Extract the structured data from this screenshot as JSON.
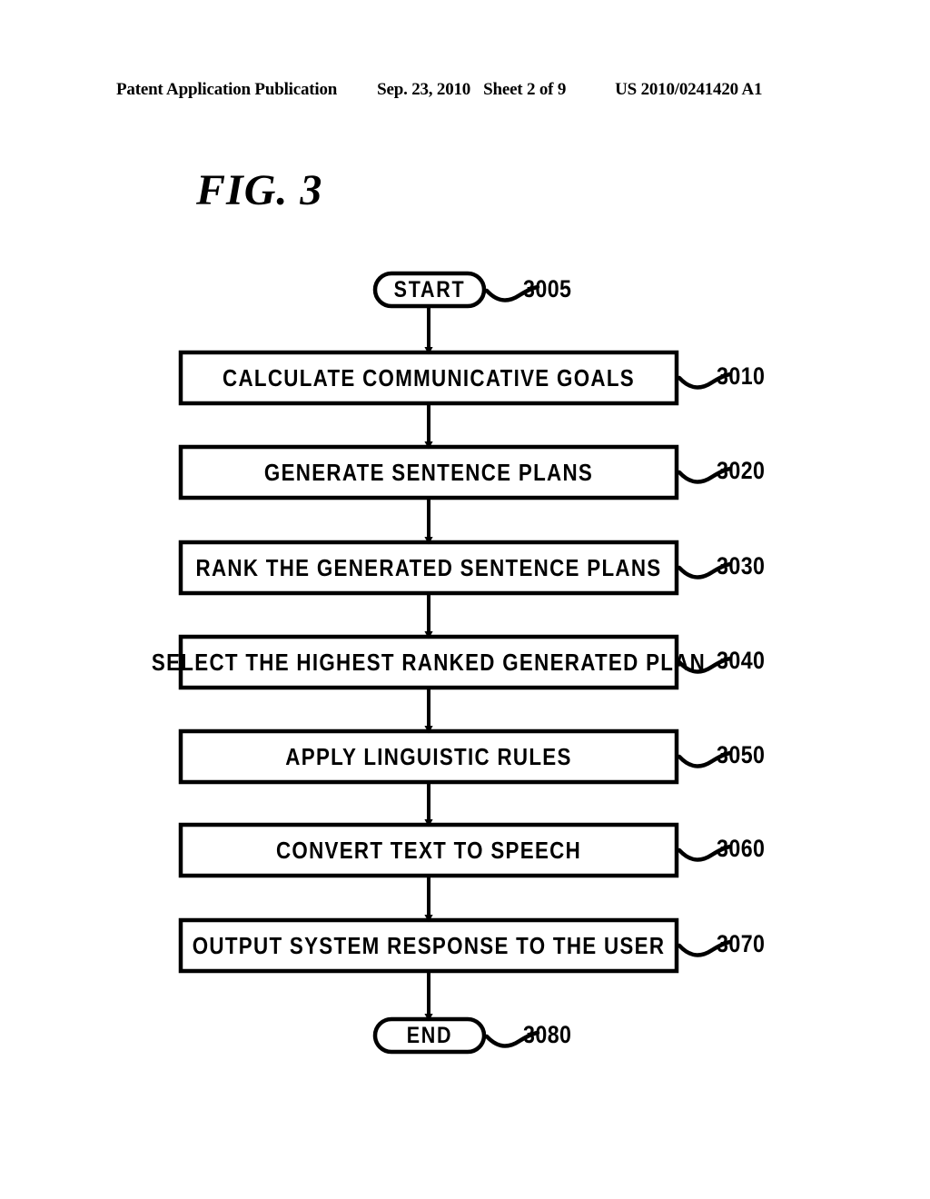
{
  "header": {
    "publication": "Patent Application Publication",
    "date": "Sep. 23, 2010",
    "sheet": "Sheet 2 of 9",
    "publication_number": "US 2010/0241420 A1"
  },
  "figure": {
    "title": "FIG. 3",
    "type": "flowchart",
    "colors": {
      "ink": "#000000",
      "page": "#ffffff"
    },
    "nodes": [
      {
        "id": "n3005",
        "shape": "terminal",
        "label": "START",
        "ref": "3005"
      },
      {
        "id": "n3010",
        "shape": "process",
        "label": "CALCULATE  COMMUNICATIVE  GOALS",
        "ref": "3010"
      },
      {
        "id": "n3020",
        "shape": "process",
        "label": "GENERATE  SENTENCE  PLANS",
        "ref": "3020"
      },
      {
        "id": "n3030",
        "shape": "process",
        "label": "RANK  THE  GENERATED  SENTENCE  PLANS",
        "ref": "3030"
      },
      {
        "id": "n3040",
        "shape": "process",
        "label": "SELECT  THE  HIGHEST  RANKED  GENERATED  PLAN",
        "ref": "3040"
      },
      {
        "id": "n3050",
        "shape": "process",
        "label": "APPLY  LINGUISTIC  RULES",
        "ref": "3050"
      },
      {
        "id": "n3060",
        "shape": "process",
        "label": "CONVERT  TEXT  TO  SPEECH",
        "ref": "3060"
      },
      {
        "id": "n3070",
        "shape": "process",
        "label": "OUTPUT  SYSTEM  RESPONSE  TO  THE  USER",
        "ref": "3070"
      },
      {
        "id": "n3080",
        "shape": "terminal",
        "label": "END",
        "ref": "3080"
      }
    ],
    "edges": [
      {
        "from": "n3005",
        "to": "n3010",
        "arrow": "down"
      },
      {
        "from": "n3010",
        "to": "n3020",
        "arrow": "down"
      },
      {
        "from": "n3020",
        "to": "n3030",
        "arrow": "down"
      },
      {
        "from": "n3030",
        "to": "n3040",
        "arrow": "down"
      },
      {
        "from": "n3040",
        "to": "n3050",
        "arrow": "down"
      },
      {
        "from": "n3050",
        "to": "n3060",
        "arrow": "down"
      },
      {
        "from": "n3060",
        "to": "n3070",
        "arrow": "down"
      },
      {
        "from": "n3070",
        "to": "n3080",
        "arrow": "down"
      }
    ]
  }
}
